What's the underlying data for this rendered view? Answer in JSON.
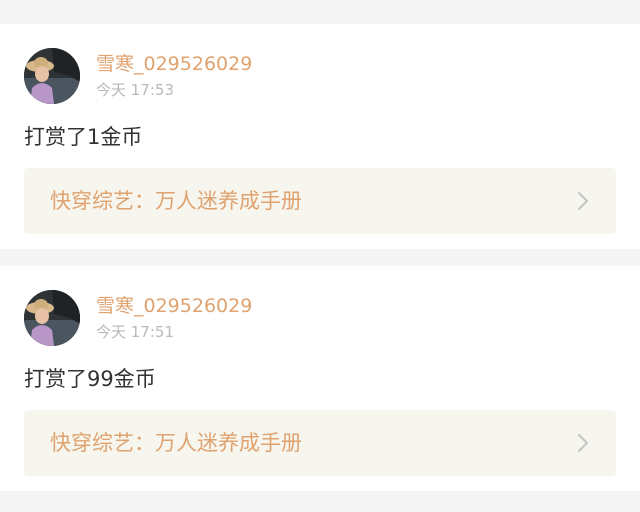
{
  "feed": {
    "items": [
      {
        "username": "雪寒_029526029",
        "time": "今天 17:53",
        "message": "打赏了1金币",
        "book_title": "快穿综艺：万人迷养成手册",
        "chevron_icon": "chevron-right-icon",
        "avatar_icon": "user-avatar"
      },
      {
        "username": "雪寒_029526029",
        "time": "今天 17:51",
        "message": "打赏了99金币",
        "book_title": "快穿综艺：万人迷养成手册",
        "chevron_icon": "chevron-right-icon",
        "avatar_icon": "user-avatar"
      }
    ]
  },
  "colors": {
    "username": "#e0a36f",
    "book_title": "#e0a36f",
    "time": "#b9b9b9",
    "message": "#333333",
    "book_link_bg": "#f6f5ee",
    "page_bg": "#f5f5f5",
    "card_bg": "#ffffff"
  }
}
